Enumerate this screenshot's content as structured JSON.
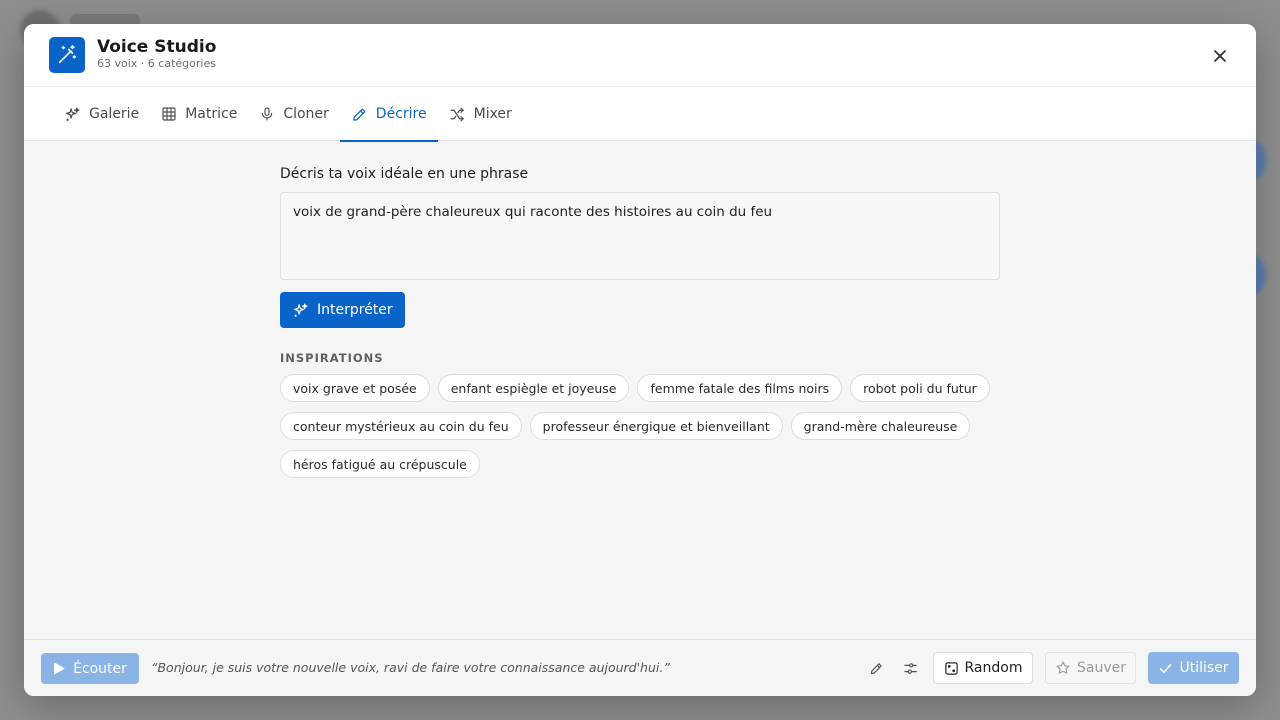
{
  "header": {
    "title": "Voice Studio",
    "subtitle": "63 voix · 6 catégories",
    "app_icon": "magic-wand-icon",
    "close_icon": "close-icon"
  },
  "tabs": [
    {
      "label": "Galerie",
      "icon": "sparkles-icon",
      "active": false
    },
    {
      "label": "Matrice",
      "icon": "grid-icon",
      "active": false
    },
    {
      "label": "Cloner",
      "icon": "microphone-icon",
      "active": false
    },
    {
      "label": "Décrire",
      "icon": "pencil-icon",
      "active": true
    },
    {
      "label": "Mixer",
      "icon": "shuffle-icon",
      "active": false
    }
  ],
  "describe": {
    "prompt_label": "Décris ta voix idéale en une phrase",
    "input_value": "voix de grand-père chaleureux qui raconte des histoires au coin du feu",
    "interpret_label": "Interpréter",
    "inspirations_label": "INSPIRATIONS",
    "inspirations": [
      "voix grave et posée",
      "enfant espiègle et joyeuse",
      "femme fatale des films noirs",
      "robot poli du futur",
      "conteur mystérieux au coin du feu",
      "professeur énergique et bienveillant",
      "grand-mère chaleureuse",
      "héros fatigué au crépuscule"
    ]
  },
  "footer": {
    "listen_label": "Écouter",
    "preview_text": "“Bonjour, je suis votre nouvelle voix, ravi de faire votre connaissance aujourd'hui.”",
    "random_label": "Random",
    "save_label": "Sauver",
    "use_label": "Utiliser"
  },
  "colors": {
    "accent": "#0a63c9",
    "accent_disabled": "#8ab3e6"
  }
}
